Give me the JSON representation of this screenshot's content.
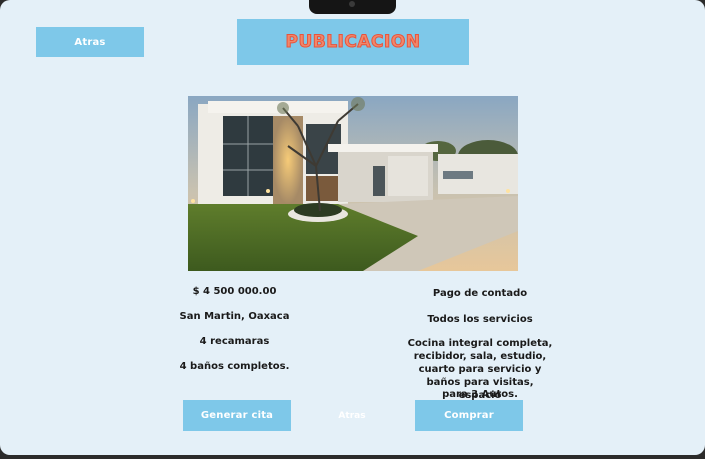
{
  "header": {
    "back_label": "Atras",
    "title": "PUBLICACION"
  },
  "listing": {
    "price": "$ 4 500 000.00",
    "location": "San Martin, Oaxaca",
    "bedrooms": "4 recamaras",
    "bathrooms": "4 baños completos.",
    "payment": "Pago de contado",
    "services": "Todos los servicios",
    "description_lines": [
      "Cocina integral completa,",
      "recibidor, sala, estudio,",
      "cuarto para servicio y",
      "baños para visitas, espacio",
      "para 3 Autos."
    ]
  },
  "actions": {
    "schedule_label": "Generar cita",
    "back_label": "Atras",
    "buy_label": "Comprar"
  },
  "colors": {
    "background": "#e4f0f8",
    "button": "#7ec8e9",
    "title_text": "#f0876a"
  }
}
